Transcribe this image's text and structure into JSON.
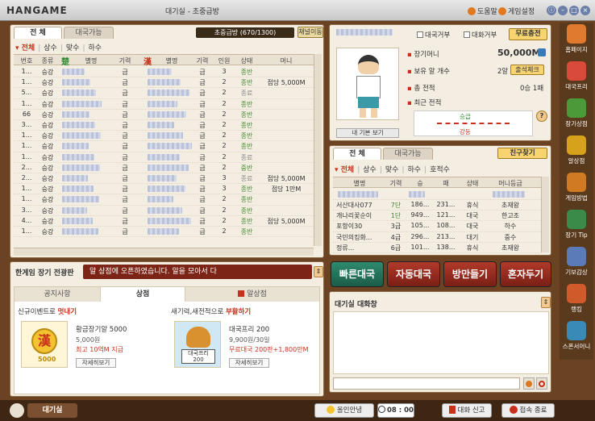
{
  "titlebar": {
    "logo": "HANGAME",
    "title": "대기실 - 초중급방",
    "help": "도움말",
    "settings": "게임설정",
    "win_buttons": [
      "ⓘ",
      "–",
      "□",
      "×"
    ]
  },
  "lobby": {
    "tabs": [
      "전 체",
      "대국가능"
    ],
    "room_info": "초중급방 (670/1300)",
    "channel_move": "채널이동",
    "filters": [
      "전체",
      "상수",
      "맞수",
      "하수"
    ],
    "columns": [
      "번호",
      "종류",
      "楚",
      "별명",
      "기력",
      "漢",
      "별명",
      "기력",
      "인원",
      "상태",
      "머니"
    ],
    "rows": [
      {
        "no": "1...",
        "kind": "승강",
        "g1": "급",
        "g2": "급",
        "people": "3",
        "state": "종반",
        "money": ""
      },
      {
        "no": "1...",
        "kind": "승강",
        "g1": "급",
        "g2": "급",
        "people": "2",
        "state": "종반",
        "money": "점당 5,000M"
      },
      {
        "no": "5...",
        "kind": "승강",
        "g1": "급",
        "g2": "급",
        "people": "2",
        "state": "종료",
        "money": ""
      },
      {
        "no": "1...",
        "kind": "승강",
        "g1": "급",
        "g2": "급",
        "people": "2",
        "state": "종반",
        "money": ""
      },
      {
        "no": "66",
        "kind": "승강",
        "g1": "급",
        "g2": "급",
        "people": "2",
        "state": "종반",
        "money": ""
      },
      {
        "no": "3...",
        "kind": "승강",
        "g1": "급",
        "g2": "급",
        "people": "2",
        "state": "종반",
        "money": ""
      },
      {
        "no": "1...",
        "kind": "승강",
        "g1": "급",
        "g2": "급",
        "people": "2",
        "state": "종반",
        "money": ""
      },
      {
        "no": "1...",
        "kind": "승강",
        "g1": "급",
        "g2": "급",
        "people": "2",
        "state": "종반",
        "money": ""
      },
      {
        "no": "1...",
        "kind": "승강",
        "g1": "급",
        "g2": "급",
        "people": "2",
        "state": "종료",
        "money": ""
      },
      {
        "no": "2...",
        "kind": "승강",
        "g1": "급",
        "g2": "급",
        "people": "2",
        "state": "중반",
        "money": ""
      },
      {
        "no": "2...",
        "kind": "승강",
        "g1": "급",
        "g2": "급",
        "people": "3",
        "state": "종료",
        "money": "점당 5,000M"
      },
      {
        "no": "1...",
        "kind": "승강",
        "g1": "급",
        "g2": "급",
        "people": "3",
        "state": "종반",
        "money": "점당 1만M"
      },
      {
        "no": "1...",
        "kind": "승강",
        "g1": "급",
        "g2": "급",
        "people": "2",
        "state": "종반",
        "money": ""
      },
      {
        "no": "3...",
        "kind": "승강",
        "g1": "급",
        "g2": "급",
        "people": "2",
        "state": "종반",
        "money": ""
      },
      {
        "no": "4...",
        "kind": "승강",
        "g1": "급",
        "g2": "급",
        "people": "2",
        "state": "종반",
        "money": "점당 5,000M"
      },
      {
        "no": "1...",
        "kind": "승강",
        "g1": "급",
        "g2": "급",
        "people": "2",
        "state": "종반",
        "money": ""
      }
    ]
  },
  "promo": {
    "title": "한게임 장기 전광판",
    "marquee": "알 상점에 오픈하였습니다. 알을 모아서 다",
    "tabs": [
      "공지사항",
      "상점",
      "알상점"
    ],
    "cards": [
      {
        "head_pre": "신규이벤트로 ",
        "head_em": "멋내기",
        "name": "황금장기알 5000",
        "price": "5,000원",
        "note": "최고 10억M 지급",
        "thumb_text": "漢",
        "thumb_sub": "5000",
        "detail": "자세히보기"
      },
      {
        "head_pre": "새기력,새전적으로 ",
        "head_em": "부활하기",
        "name": "대국프리 200",
        "price": "9,900원/30일",
        "note": "무료대국 200판+1,800만M",
        "thumb_text": "대국프리",
        "thumb_sub": "200",
        "detail": "자세히보기"
      }
    ]
  },
  "profile": {
    "reject_match": "대국거부",
    "reject_chat": "대화거부",
    "free_charge": "무료충전",
    "money_label": "장기머니",
    "money_value": "50,000M",
    "egg_label": "보유 알 개수",
    "egg_value": "2알",
    "attendance": "출석체크",
    "record_label": "총 전적",
    "record_value": "0승 1패",
    "recent_label": "최근 전적",
    "rank_up": "승급",
    "rank_down": "강등",
    "info_button": "내 기본 보기",
    "help_q": "?"
  },
  "friends": {
    "tabs": [
      "전 체",
      "대국가능"
    ],
    "find_friends": "친구찾기",
    "filters": [
      "전체",
      "상수",
      "맞수",
      "하수",
      "호적수"
    ],
    "columns": [
      "별명",
      "기력",
      "승",
      "패",
      "상태",
      "머니등급"
    ],
    "rows": [
      {
        "name": "서산대사077",
        "grade": "7단",
        "win": "186...",
        "lose": "231...",
        "state": "휴식",
        "money": "초재왕"
      },
      {
        "name": "개나리꽃순이",
        "grade": "1단",
        "win": "949...",
        "lose": "121...",
        "state": "대국",
        "money": "한고조"
      },
      {
        "name": "포항이30",
        "grade": "3급",
        "win": "105...",
        "lose": "108...",
        "state": "대국",
        "money": "하수"
      },
      {
        "name": "국민의킹화...",
        "grade": "4급",
        "win": "296...",
        "lose": "213...",
        "state": "대기",
        "money": "중수"
      },
      {
        "name": "정류...",
        "grade": "6급",
        "win": "101...",
        "lose": "138...",
        "state": "휴식",
        "money": "초재왕"
      }
    ]
  },
  "actions": {
    "quick": "빠른대국",
    "auto": "자동대국",
    "create": "방만들기",
    "solo": "혼자두기"
  },
  "chat": {
    "title": "대기실 대화창",
    "scroll": "⇕"
  },
  "sidebar": [
    {
      "label": "홈페이지",
      "color": "#e07a2e"
    },
    {
      "label": "대국프리",
      "color": "#d94a3a"
    },
    {
      "label": "장기상점",
      "color": "#4a9a3a"
    },
    {
      "label": "알상점",
      "color": "#d6a21c"
    },
    {
      "label": "게임방법",
      "color": "#d07a24"
    },
    {
      "label": "장기 Tip",
      "color": "#3a8a4a"
    },
    {
      "label": "기보감상",
      "color": "#5a7ab8"
    },
    {
      "label": "랭킹",
      "color": "#d05a2a"
    },
    {
      "label": "스폰서머니",
      "color": "#3a8ab8"
    }
  ],
  "bottombar": {
    "location": "대기실",
    "bye": "올인안녕",
    "time": "08 : 00",
    "report": "대화 신고",
    "exit": "접속 종료"
  }
}
